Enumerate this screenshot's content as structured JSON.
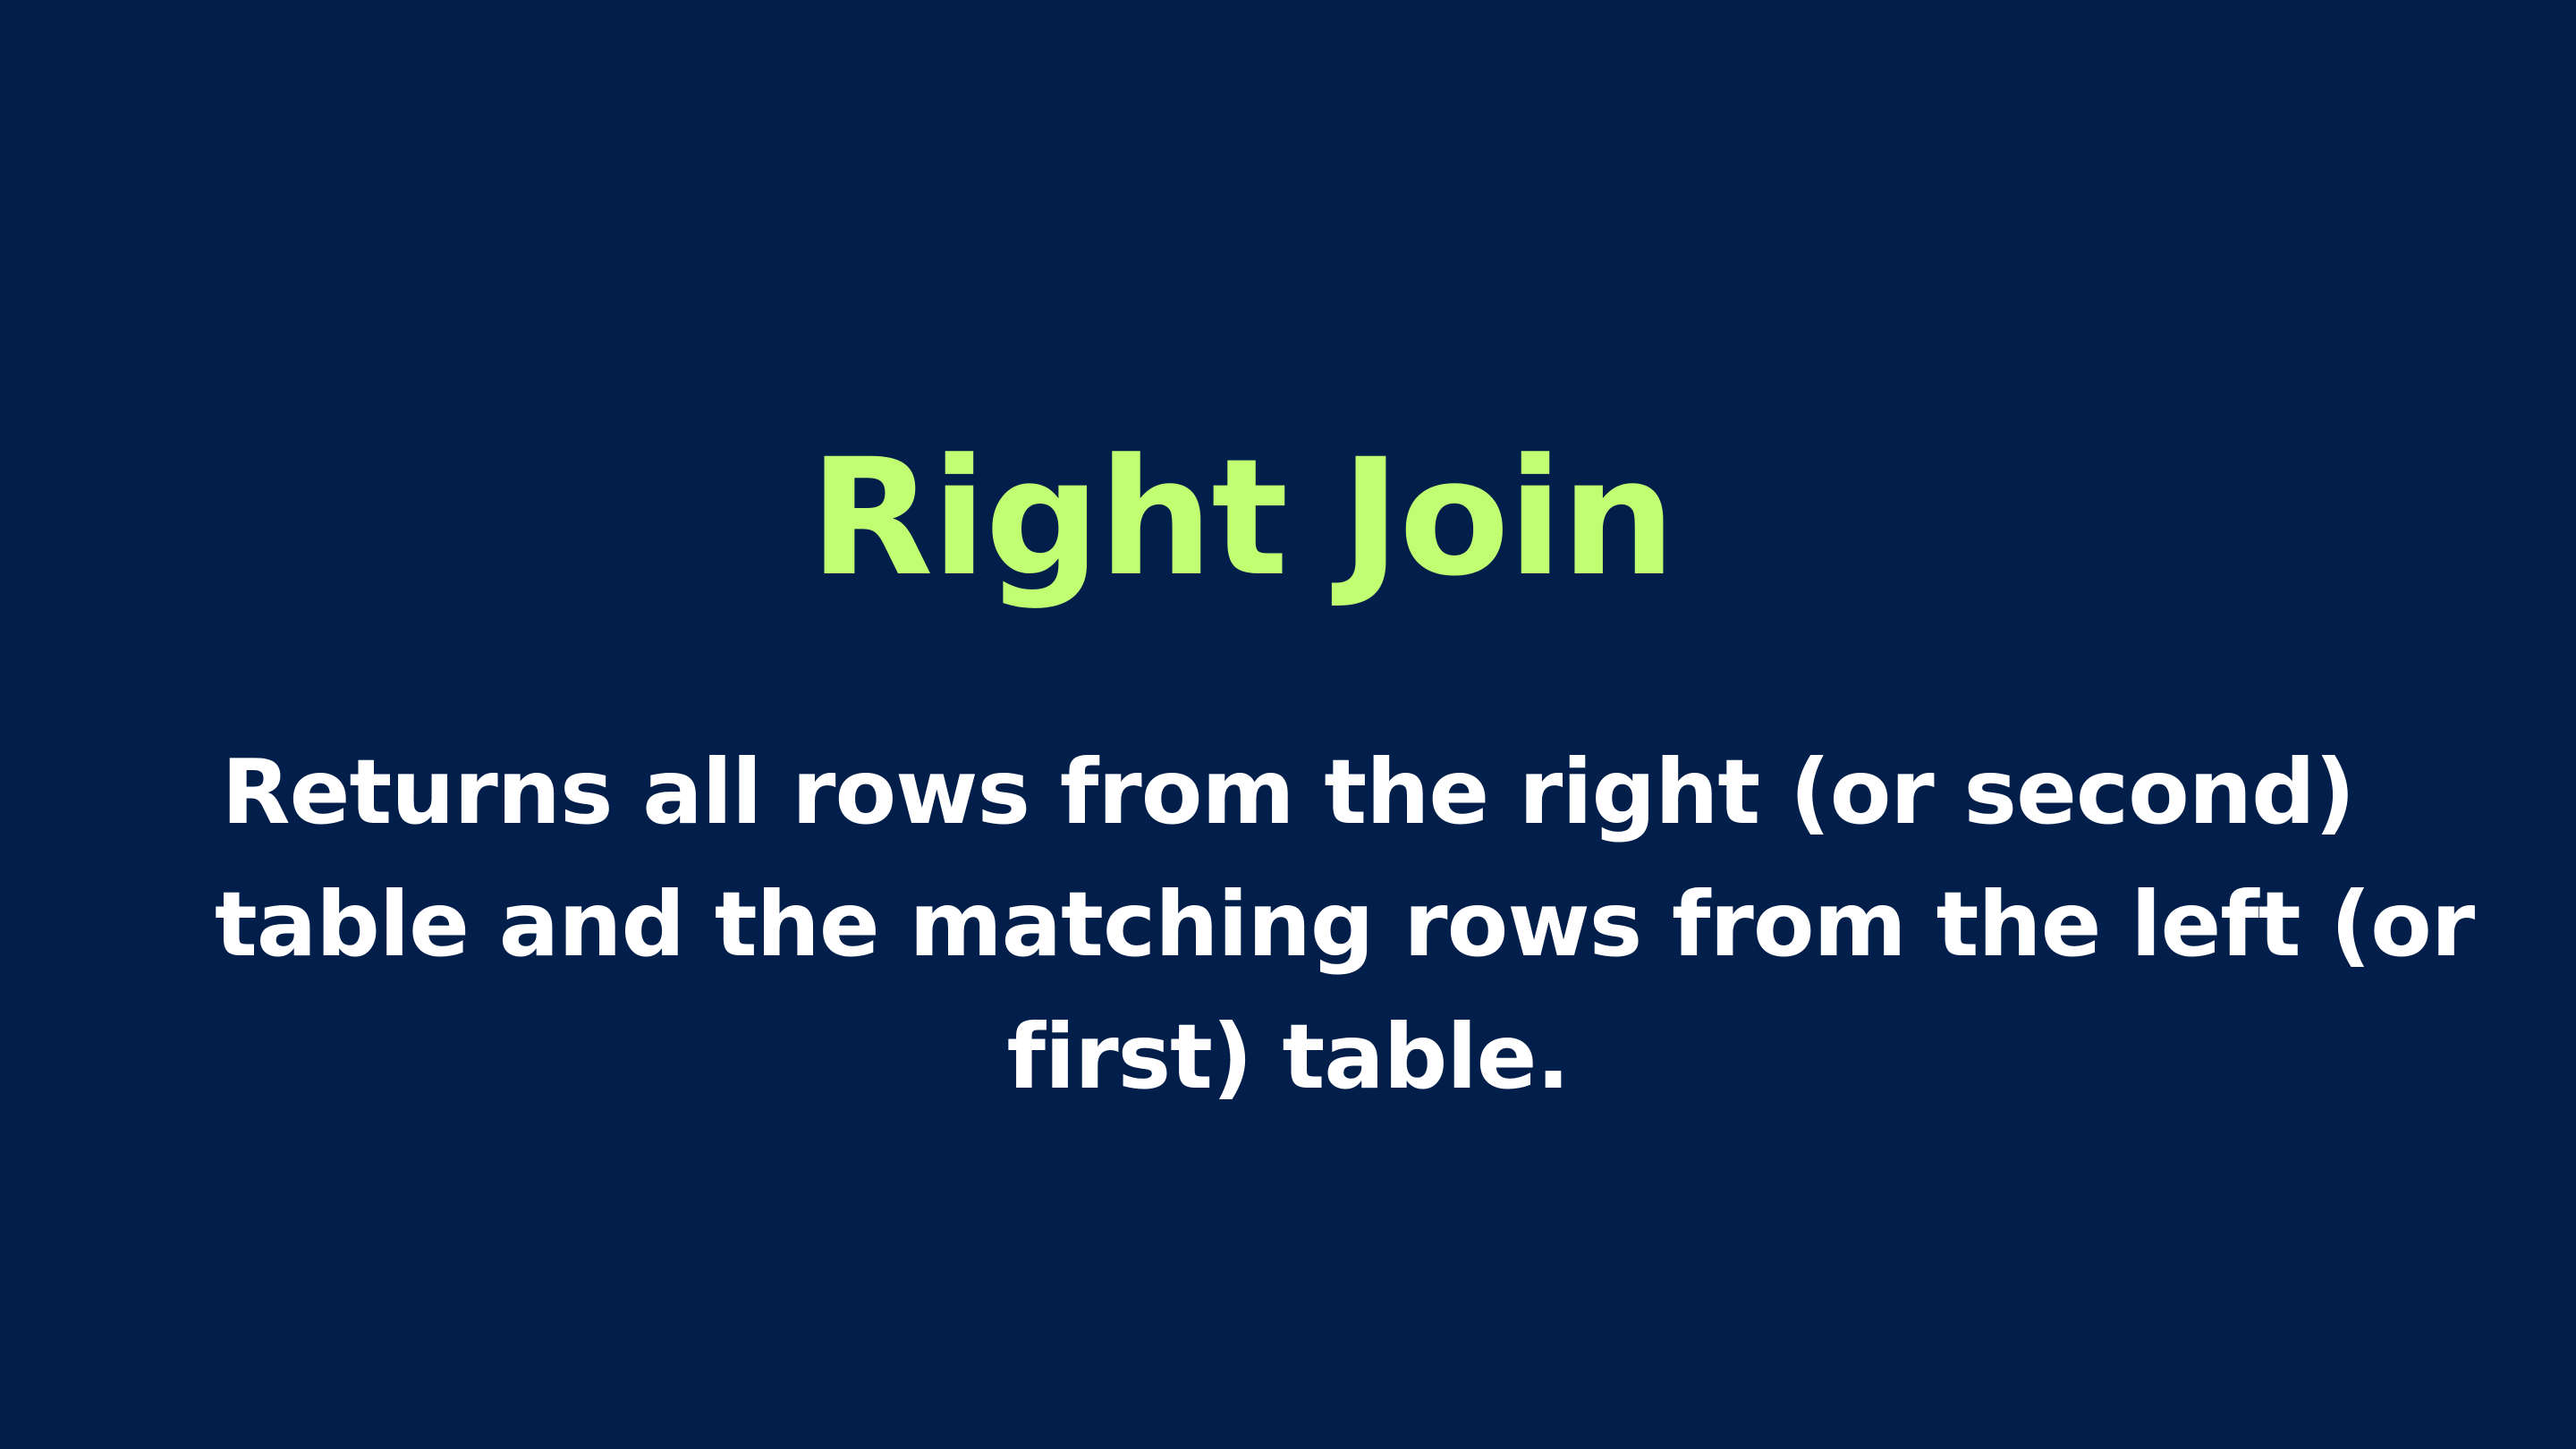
{
  "slide": {
    "title": "Right Join",
    "description_lines": [
      "Returns all rows from the right (or second)",
      "table and the matching rows from the left (or",
      "first) table."
    ]
  },
  "colors": {
    "background": "#021f4b",
    "title": "#c1ff72",
    "text": "#ffffff"
  }
}
